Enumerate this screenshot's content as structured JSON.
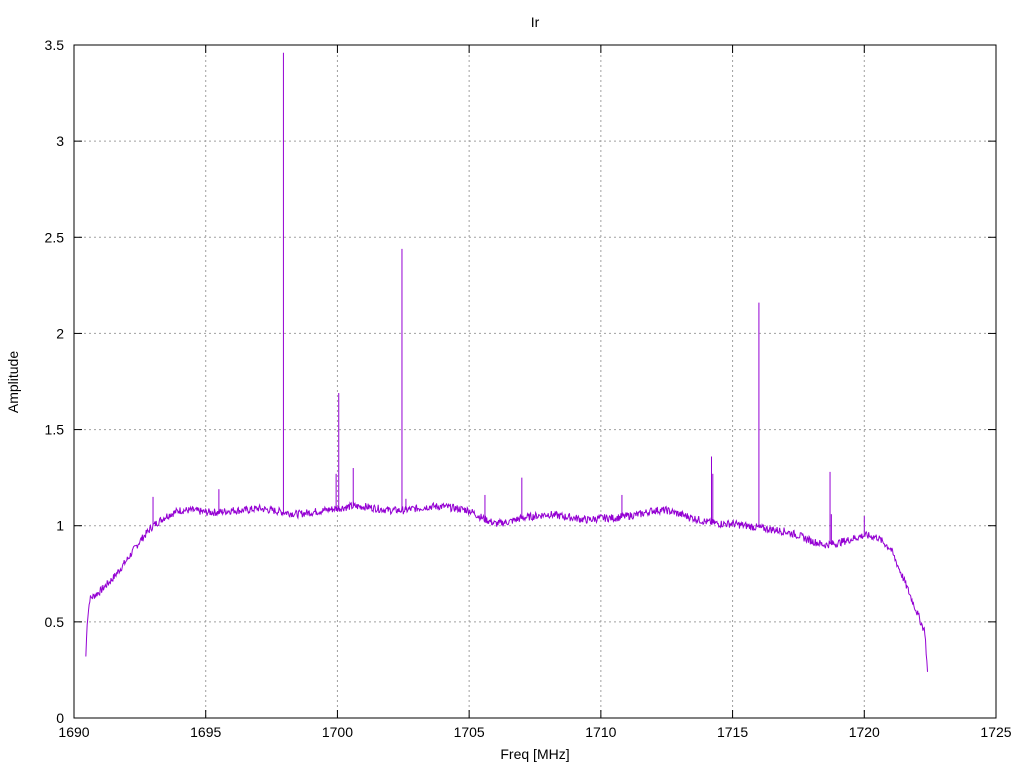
{
  "chart_data": {
    "type": "line",
    "title": "Ir",
    "xlabel": "Freq [MHz]",
    "ylabel": "Amplitude",
    "xlim": [
      1690,
      1725
    ],
    "ylim": [
      0,
      3.5
    ],
    "xticks": [
      1690,
      1695,
      1700,
      1705,
      1710,
      1715,
      1720,
      1725
    ],
    "yticks": [
      0,
      0.5,
      1,
      1.5,
      2,
      2.5,
      3,
      3.5
    ],
    "grid": true,
    "legend": "none",
    "series": [
      {
        "color": "#9400d3",
        "x": [
          1690.45,
          1690.5,
          1690.6,
          1690.8,
          1691.0,
          1691.5,
          1692.0,
          1692.5,
          1693.0,
          1693.5,
          1694.0,
          1694.5,
          1695.0,
          1695.5,
          1696.0,
          1696.5,
          1697.0,
          1697.5,
          1698.0,
          1698.5,
          1699.0,
          1699.5,
          1700.0,
          1700.5,
          1701.0,
          1701.5,
          1702.0,
          1702.5,
          1703.0,
          1703.5,
          1704.0,
          1704.5,
          1705.0,
          1705.5,
          1706.0,
          1706.5,
          1707.0,
          1707.5,
          1708.0,
          1708.5,
          1709.0,
          1709.5,
          1710.0,
          1710.5,
          1711.0,
          1711.5,
          1712.0,
          1712.5,
          1713.0,
          1713.5,
          1714.0,
          1714.5,
          1715.0,
          1715.5,
          1716.0,
          1716.5,
          1717.0,
          1717.5,
          1718.0,
          1718.5,
          1719.0,
          1719.5,
          1720.0,
          1720.5,
          1721.0,
          1721.5,
          1722.0,
          1722.2,
          1722.3,
          1722.4
        ],
        "y": [
          0.32,
          0.5,
          0.62,
          0.64,
          0.66,
          0.73,
          0.82,
          0.92,
          1.0,
          1.05,
          1.08,
          1.08,
          1.07,
          1.07,
          1.08,
          1.08,
          1.09,
          1.08,
          1.07,
          1.06,
          1.07,
          1.08,
          1.09,
          1.1,
          1.1,
          1.09,
          1.08,
          1.08,
          1.09,
          1.1,
          1.1,
          1.09,
          1.08,
          1.04,
          1.01,
          1.02,
          1.04,
          1.05,
          1.06,
          1.05,
          1.04,
          1.03,
          1.04,
          1.04,
          1.05,
          1.06,
          1.08,
          1.08,
          1.06,
          1.04,
          1.02,
          1.01,
          1.01,
          1.0,
          0.99,
          0.98,
          0.97,
          0.95,
          0.92,
          0.9,
          0.91,
          0.93,
          0.95,
          0.94,
          0.88,
          0.72,
          0.55,
          0.48,
          0.45,
          0.24
        ],
        "spikes": [
          {
            "x": 1693.0,
            "y": 1.15
          },
          {
            "x": 1695.5,
            "y": 1.19
          },
          {
            "x": 1697.95,
            "y": 3.46
          },
          {
            "x": 1699.95,
            "y": 1.27
          },
          {
            "x": 1700.05,
            "y": 1.69
          },
          {
            "x": 1700.6,
            "y": 1.3
          },
          {
            "x": 1702.45,
            "y": 2.44
          },
          {
            "x": 1702.6,
            "y": 1.14
          },
          {
            "x": 1705.6,
            "y": 1.16
          },
          {
            "x": 1707.0,
            "y": 1.25
          },
          {
            "x": 1710.8,
            "y": 1.16
          },
          {
            "x": 1714.2,
            "y": 1.36
          },
          {
            "x": 1714.25,
            "y": 1.27
          },
          {
            "x": 1716.0,
            "y": 2.16
          },
          {
            "x": 1718.7,
            "y": 1.28
          },
          {
            "x": 1718.75,
            "y": 1.06
          },
          {
            "x": 1720.0,
            "y": 1.05
          }
        ]
      }
    ]
  }
}
